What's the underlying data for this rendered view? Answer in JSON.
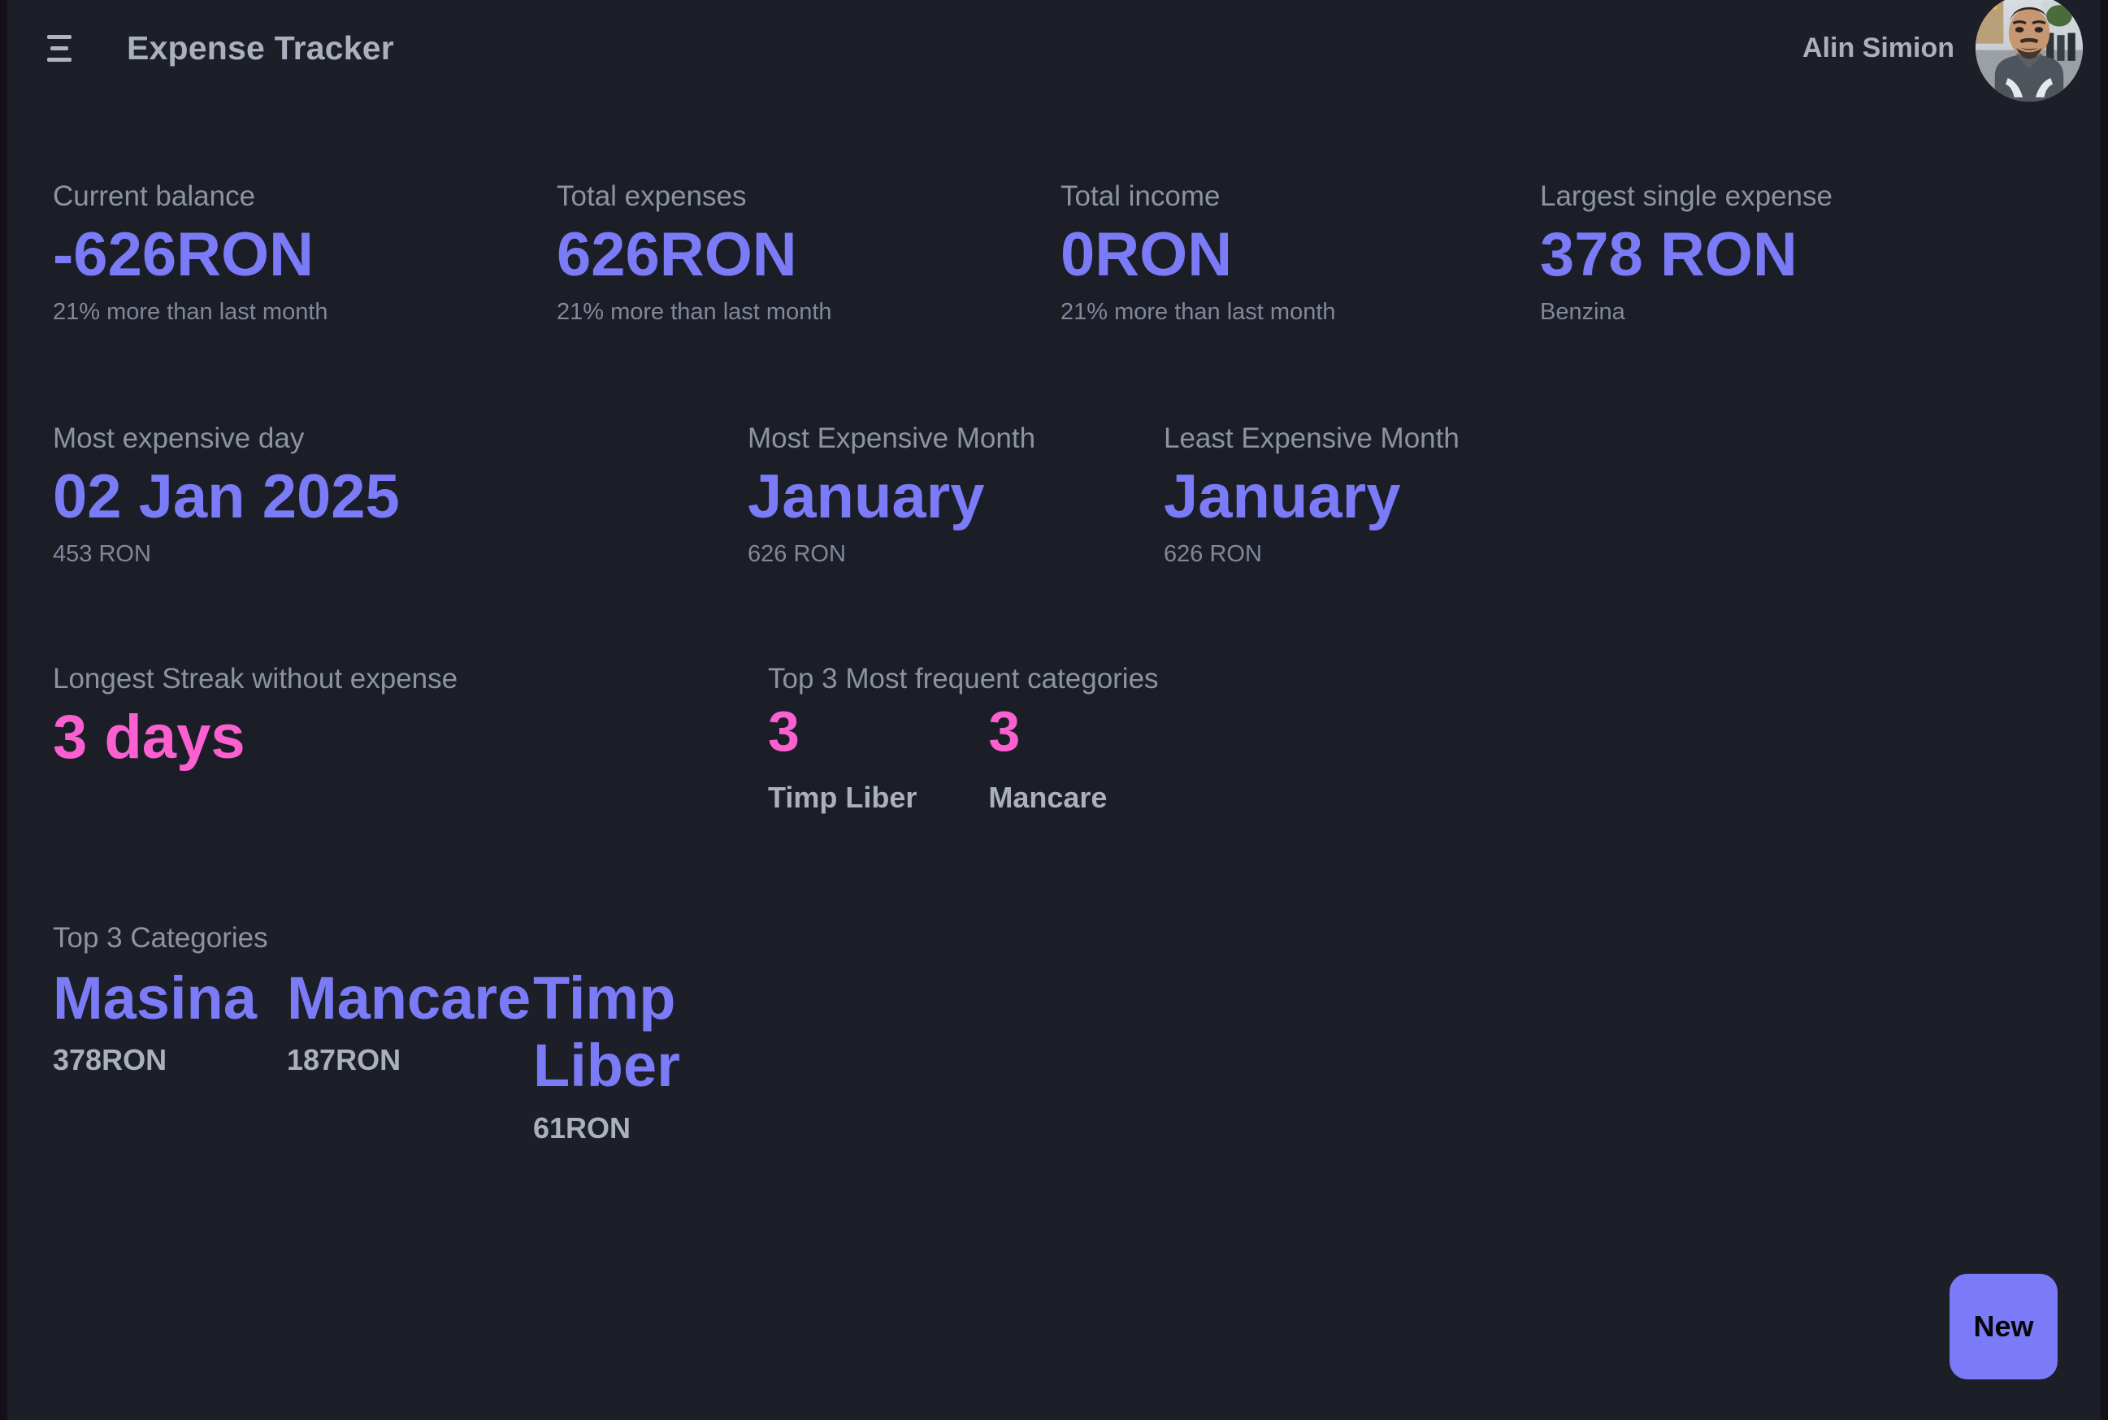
{
  "header": {
    "menu_icon": "hamburger-menu-icon",
    "title": "Expense Tracker",
    "user_name": "Alin Simion",
    "avatar_icon": "user-avatar-photo"
  },
  "colors": {
    "page_bg": "#1c1f27",
    "card_bg": "#1b1e26",
    "accent": "#7b7bf7",
    "accent_pink": "#fb5fd0",
    "label_text": "#8d93a1",
    "strong_text": "#aab0bd"
  },
  "stats_row1": [
    {
      "label": "Current balance",
      "value": "-626RON",
      "sub": "21% more than last month"
    },
    {
      "label": "Total expenses",
      "value": "626RON",
      "sub": "21% more than last month"
    },
    {
      "label": "Total income",
      "value": "0RON",
      "sub": "21% more than last month"
    },
    {
      "label": "Largest single expense",
      "value": "378 RON",
      "sub": "Benzina"
    }
  ],
  "stats_row2": [
    {
      "label": "Most expensive day",
      "value": "02 Jan 2025",
      "sub": "453 RON"
    },
    {
      "label": "Most Expensive Month",
      "value": "January",
      "sub": "626 RON"
    },
    {
      "label": "Least Expensive Month",
      "value": "January",
      "sub": "626 RON"
    }
  ],
  "streak": {
    "label": "Longest Streak without expense",
    "value": "3 days"
  },
  "frequent": {
    "label": "Top 3 Most frequent categories",
    "items": [
      {
        "count": "3",
        "name": "Timp Liber"
      },
      {
        "count": "3",
        "name": "Mancare"
      }
    ]
  },
  "top_categories": {
    "label": "Top 3 Categories",
    "items": [
      {
        "name": "Masina",
        "amount": "378RON"
      },
      {
        "name": "Mancare",
        "amount": "187RON"
      },
      {
        "name": "Timp Liber",
        "amount": "61RON"
      }
    ]
  },
  "new_button": {
    "label": "New"
  }
}
